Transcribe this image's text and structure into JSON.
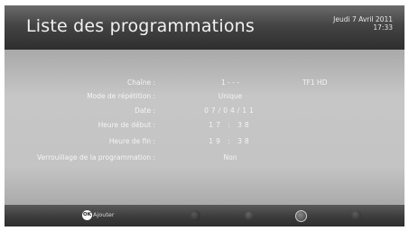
{
  "header": {
    "title": "Liste des programmations",
    "date": "Jeudi 7 Avril 2011",
    "time": "17:33"
  },
  "fields": [
    {
      "label": "Chaîne :",
      "value": "1 - - -",
      "extra": "TF1 HD"
    },
    {
      "label": "Mode de répétition :",
      "value": "Unique"
    },
    {
      "label": "Date :",
      "value": "07/04/11"
    },
    {
      "label": "Heure de début :",
      "value": "17 : 38"
    },
    {
      "label": "Heure de fin :",
      "value": "19 : 38"
    },
    {
      "label": "Verrouillage de la programmation :",
      "value": "Non"
    }
  ],
  "footer": {
    "ok_icon": "OK",
    "ok_label": "Ajouter",
    "color_buttons": [
      "red",
      "green",
      "yellow",
      "blue"
    ]
  }
}
